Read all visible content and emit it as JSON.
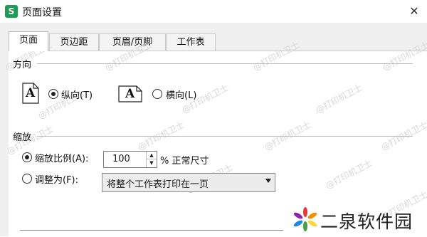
{
  "window": {
    "title": "页面设置",
    "app_icon_text": "S",
    "close_symbol": "✕"
  },
  "tabs": [
    {
      "label": "页面",
      "active": true
    },
    {
      "label": "页边距",
      "active": false
    },
    {
      "label": "页眉/页脚",
      "active": false
    },
    {
      "label": "工作表",
      "active": false
    }
  ],
  "orientation": {
    "section_label": "方向",
    "icon_letter": "A",
    "portrait_label": "纵向(T)",
    "landscape_label": "横向(L)",
    "selected": "portrait"
  },
  "scaling": {
    "section_label": "缩放",
    "scale_option_label": "缩放比例(A):",
    "scale_value": "100",
    "scale_suffix": "% 正常尺寸",
    "fit_option_label": "调整为(F):",
    "fit_select_value": "将整个工作表打印在一页",
    "selected": "scale"
  },
  "watermark_text": "@打印机卫士",
  "brand": {
    "text": "二泉软件园"
  },
  "colors": {
    "accent_green": "#1e9b55",
    "panel_bg": "#ffffff",
    "dialog_bg": "#f0f0f0"
  }
}
